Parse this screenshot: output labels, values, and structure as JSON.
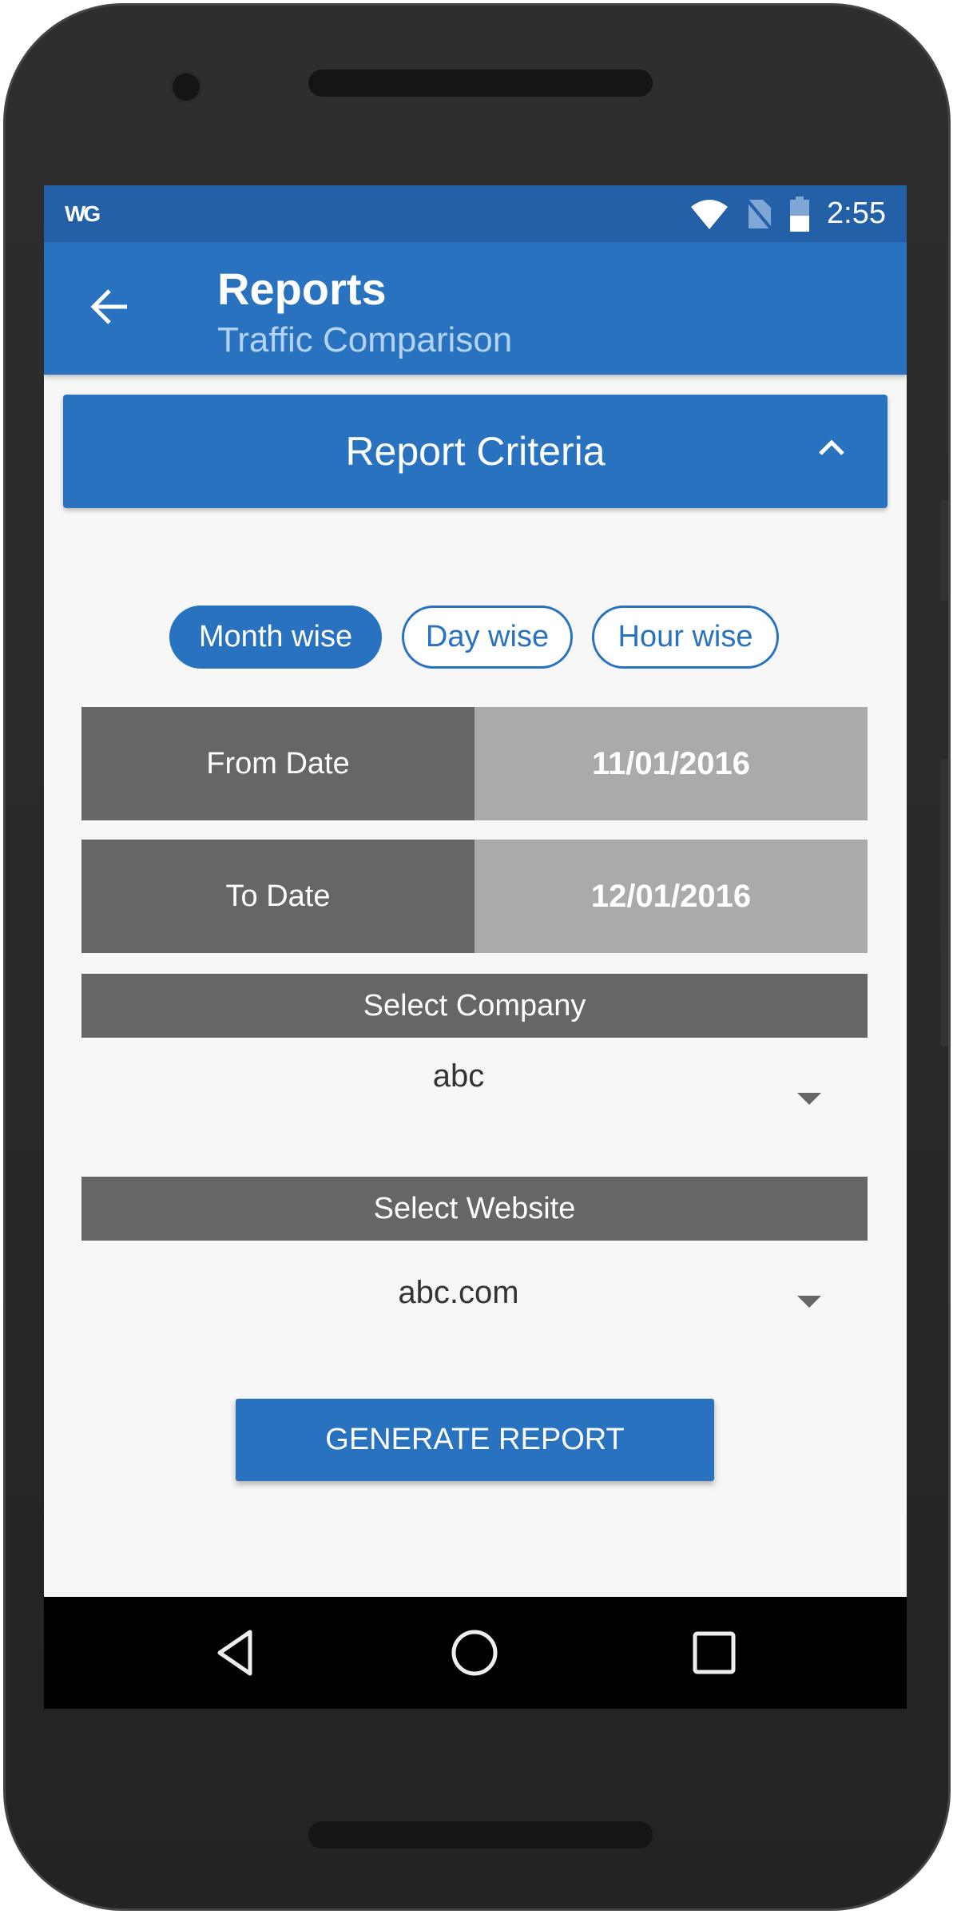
{
  "status_bar": {
    "logo": "WG",
    "time": "2:55",
    "icons": [
      "wifi-icon",
      "no-sim-icon",
      "battery-icon"
    ]
  },
  "app_bar": {
    "title": "Reports",
    "subtitle": "Traffic Comparison",
    "back_icon": "arrow-left-icon"
  },
  "criteria": {
    "title": "Report Criteria",
    "toggle_icon": "chevron-up-icon"
  },
  "modes": [
    {
      "label": "Month wise",
      "active": true
    },
    {
      "label": "Day wise",
      "active": false
    },
    {
      "label": "Hour wise",
      "active": false
    }
  ],
  "from_date": {
    "label": "From Date",
    "value": "11/01/2016"
  },
  "to_date": {
    "label": "To Date",
    "value": "12/01/2016"
  },
  "company": {
    "label": "Select Company",
    "value": "abc"
  },
  "website": {
    "label": "Select Website",
    "value": "abc.com"
  },
  "generate_label": "GENERATE REPORT",
  "nav": [
    "back-icon",
    "home-icon",
    "recents-icon"
  ],
  "colors": {
    "primary": "#2872c0",
    "status": "#2360a8",
    "label_bg": "#666666",
    "value_bg": "#aaaaaa"
  }
}
